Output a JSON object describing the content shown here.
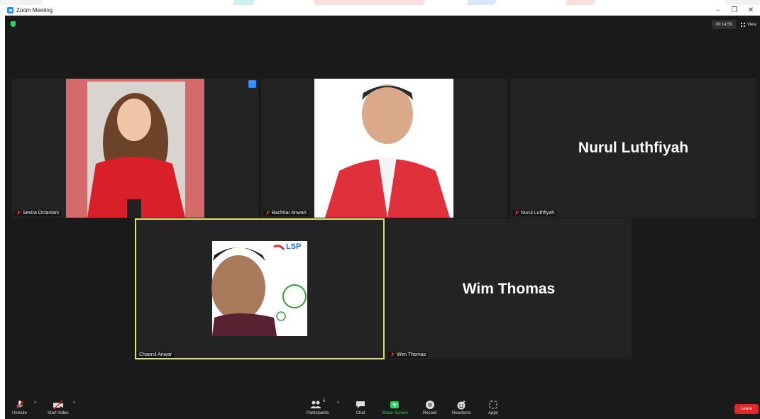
{
  "window": {
    "title": "Zoom Meeting",
    "controls": {
      "minimize": "–",
      "restore": "❐",
      "close": "✕"
    }
  },
  "header": {
    "timer": "00:14:59",
    "view_label": "View"
  },
  "participants": [
    {
      "name": "Sevira Octaviani",
      "muted": true,
      "video": "photo"
    },
    {
      "name": "Bachtiar Anwari",
      "muted": true,
      "video": "photo"
    },
    {
      "name": "Nurul Luthfiyah",
      "muted": true,
      "video": "off",
      "center_name": "Nurul Luthfiyah"
    },
    {
      "name": "Chaerul Anwar",
      "muted": false,
      "video": "photo",
      "active_speaker": true,
      "logo_text": "LSP"
    },
    {
      "name": "Wim Thomas",
      "muted": true,
      "video": "off",
      "center_name": "Wim Thomas"
    }
  ],
  "toolbar": {
    "unmute": "Unmute",
    "start_video": "Start Video",
    "participants": "Participants",
    "participants_count": "5",
    "chat": "Chat",
    "share_screen": "Share Screen",
    "record": "Record",
    "reactions": "Reactions",
    "apps": "Apps",
    "leave": "Leave"
  },
  "icons": [
    "zoom-app-icon",
    "shield-icon",
    "grid-view-icon",
    "more-options-icon",
    "mic-muted-icon",
    "video-off-icon",
    "participants-icon",
    "chat-icon",
    "share-screen-icon",
    "record-icon",
    "reactions-icon",
    "apps-icon"
  ],
  "colors": {
    "zoom_blue": "#2d8cff",
    "meeting_bg": "#1a1a1a",
    "tile_bg": "#232323",
    "active_border": "#d9e66b",
    "leave_red": "#e02828",
    "share_green": "#23d959"
  }
}
